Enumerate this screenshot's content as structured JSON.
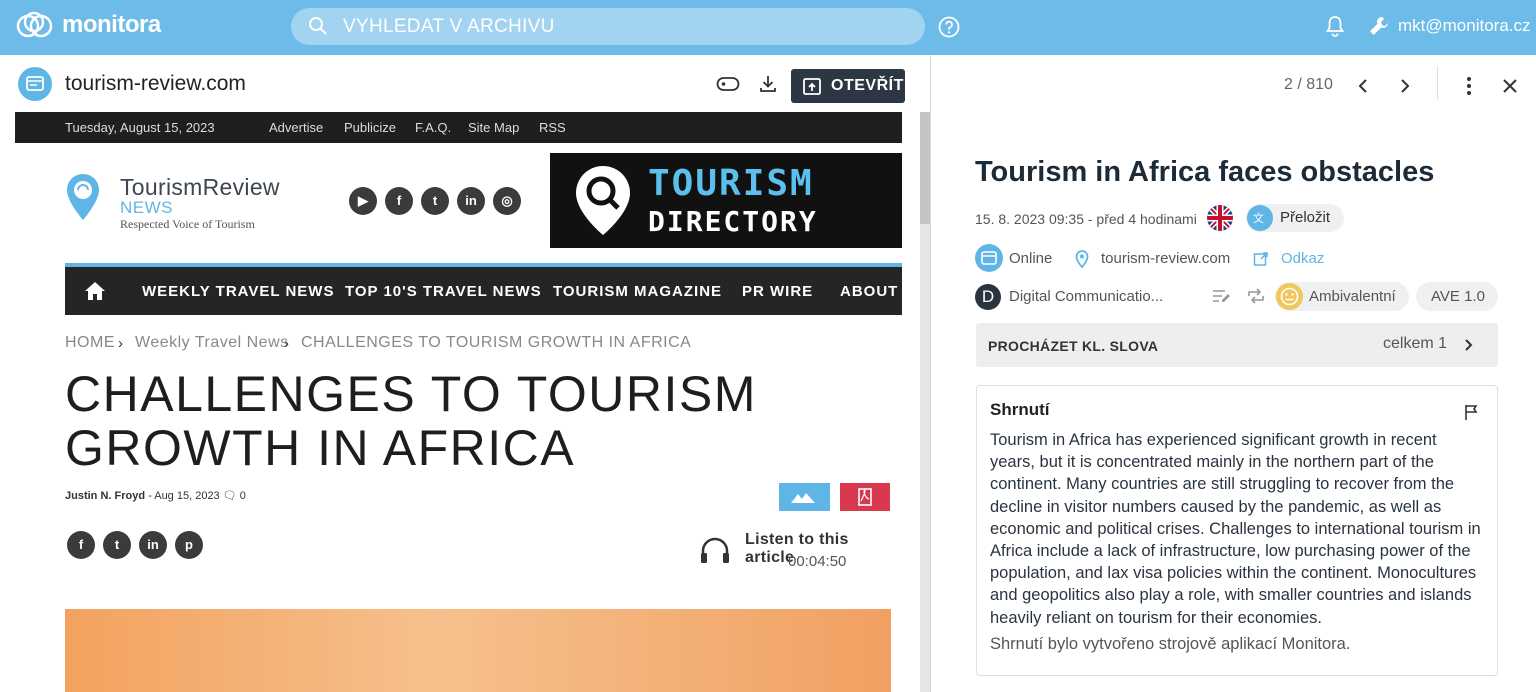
{
  "app": {
    "logo_text": "monitora",
    "search_placeholder": "VYHLEDAT V ARCHIVU",
    "user_email": "mkt@monitora.cz"
  },
  "left_panel": {
    "source_name": "tourism-review.com",
    "open_button_label": "OTEVŘÍT"
  },
  "website": {
    "topbar": {
      "date": "Tuesday, August 15, 2023",
      "links": [
        "Advertise",
        "Publicize",
        "F.A.Q.",
        "Site Map",
        "RSS"
      ]
    },
    "brand": {
      "title": "TourismReview",
      "subtitle": "NEWS",
      "tagline": "Respected Voice of Tourism"
    },
    "banner": {
      "line1": "TOURISM",
      "line2": "DIRECTORY"
    },
    "nav": [
      "WEEKLY TRAVEL NEWS",
      "TOP 10'S TRAVEL NEWS",
      "TOURISM MAGAZINE",
      "PR WIRE",
      "ABOUT"
    ],
    "breadcrumb": [
      "HOME",
      "Weekly Travel News",
      "CHALLENGES TO TOURISM GROWTH IN AFRICA"
    ],
    "article_title": "CHALLENGES TO TOURISM GROWTH IN AFRICA",
    "author": "Justin N. Froyd",
    "byline_rest": " - Aug 15, 2023 ",
    "comments": "0",
    "listen_label": "Listen to this article",
    "listen_time": "00:04:50"
  },
  "right_panel": {
    "counter": "2 / 810",
    "title": "Tourism in Africa faces obstacles",
    "date": "15. 8. 2023 09:35 - před 4 hodinami",
    "translate_label": "Přeložit",
    "medium_type": "Online",
    "source": "tourism-review.com",
    "link_label": "Odkaz",
    "publisher": "Digital Communicatio...",
    "publisher_initial": "D",
    "sentiment": "Ambivalentní",
    "ave": "AVE 1.0",
    "keywords_label": "PROCHÁZET KL. SLOVA",
    "keywords_count": "celkem 1",
    "summary_heading": "Shrnutí",
    "summary_text": "Tourism in Africa has experienced significant growth in recent years, but it is concentrated mainly in the northern part of the continent. Many countries are still struggling to recover from the decline in visitor numbers caused by the pandemic, as well as economic and political crises. Challenges to international tourism in Africa include a lack of infrastructure, low purchasing power of the population, and lax visa policies within the continent. Monocultures and geopolitics also play a role, with smaller countries and islands heavily reliant on tourism for their economies.",
    "summary_note": "Shrnutí bylo vytvořeno strojově aplikací Monitora."
  },
  "colors": {
    "topbar": "#6dbbe8",
    "accent": "#5fb6e6",
    "dark_button": "#2d3744"
  }
}
